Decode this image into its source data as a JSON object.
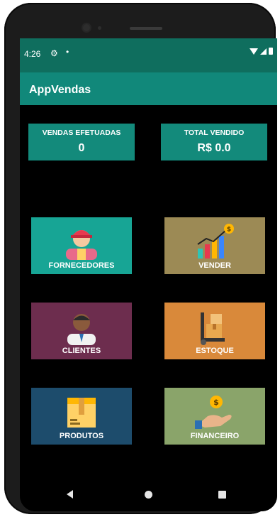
{
  "status_bar": {
    "time": "4:26",
    "settings_icon": "gear-icon",
    "notification_icon": "dot-icon"
  },
  "app_bar": {
    "title": "AppVendas"
  },
  "stats": [
    {
      "label": "VENDAS EFETUADAS",
      "value": "0"
    },
    {
      "label": "TOTAL VENDIDO",
      "value": "R$ 0.0"
    }
  ],
  "tiles": [
    {
      "label": "FORNECEDORES",
      "icon": "delivery-person-icon",
      "color": "#17a595"
    },
    {
      "label": "VENDER",
      "icon": "growth-chart-icon",
      "color": "#9c8a55"
    },
    {
      "label": "CLIENTES",
      "icon": "client-person-icon",
      "color": "#6d2d4e"
    },
    {
      "label": "ESTOQUE",
      "icon": "hand-truck-box-icon",
      "color": "#d9893a"
    },
    {
      "label": "PRODUTOS",
      "icon": "box-icon",
      "color": "#1d4c6c"
    },
    {
      "label": "FINANCEIRO",
      "icon": "hand-coin-icon",
      "color": "#8aa46a"
    }
  ],
  "nav_bar": {
    "back": "back-icon",
    "home": "home-icon",
    "recents": "recents-icon"
  }
}
